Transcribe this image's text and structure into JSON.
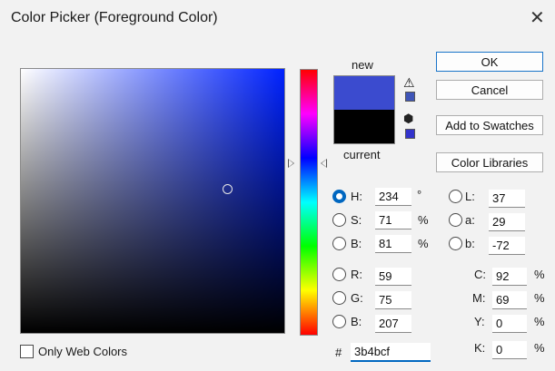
{
  "window": {
    "title": "Color Picker (Foreground Color)",
    "close_glyph": "✕"
  },
  "colors": {
    "new_color": "#3b4bcf",
    "current_color": "#000000",
    "field_hue": "#0022ff",
    "accent": "#0067c0"
  },
  "preview": {
    "new_label": "new",
    "current_label": "current",
    "warning_glyph": "⚠",
    "cube_glyph": "⬢",
    "gamut_swatch": "#3f55b8",
    "websafe_swatch": "#3333cc"
  },
  "buttons": {
    "ok": "OK",
    "cancel": "Cancel",
    "add_to_swatches": "Add to Swatches",
    "color_libraries": "Color Libraries"
  },
  "hsb": {
    "h": {
      "label": "H:",
      "value": "234",
      "unit": "°",
      "selected": true
    },
    "s": {
      "label": "S:",
      "value": "71",
      "unit": "%",
      "selected": false
    },
    "b": {
      "label": "B:",
      "value": "81",
      "unit": "%",
      "selected": false
    }
  },
  "rgb": {
    "r": {
      "label": "R:",
      "value": "59"
    },
    "g": {
      "label": "G:",
      "value": "75"
    },
    "b": {
      "label": "B:",
      "value": "207"
    }
  },
  "lab": {
    "l": {
      "label": "L:",
      "value": "37"
    },
    "a": {
      "label": "a:",
      "value": "29"
    },
    "b": {
      "label": "b:",
      "value": "-72"
    }
  },
  "cmyk": {
    "c": {
      "label": "C:",
      "value": "92",
      "unit": "%"
    },
    "m": {
      "label": "M:",
      "value": "69",
      "unit": "%"
    },
    "y": {
      "label": "Y:",
      "value": "0",
      "unit": "%"
    },
    "k": {
      "label": "K:",
      "value": "0",
      "unit": "%"
    }
  },
  "hex": {
    "prefix": "#",
    "value": "3b4bcf"
  },
  "web_colors": {
    "label": "Only Web Colors",
    "checked": false
  }
}
